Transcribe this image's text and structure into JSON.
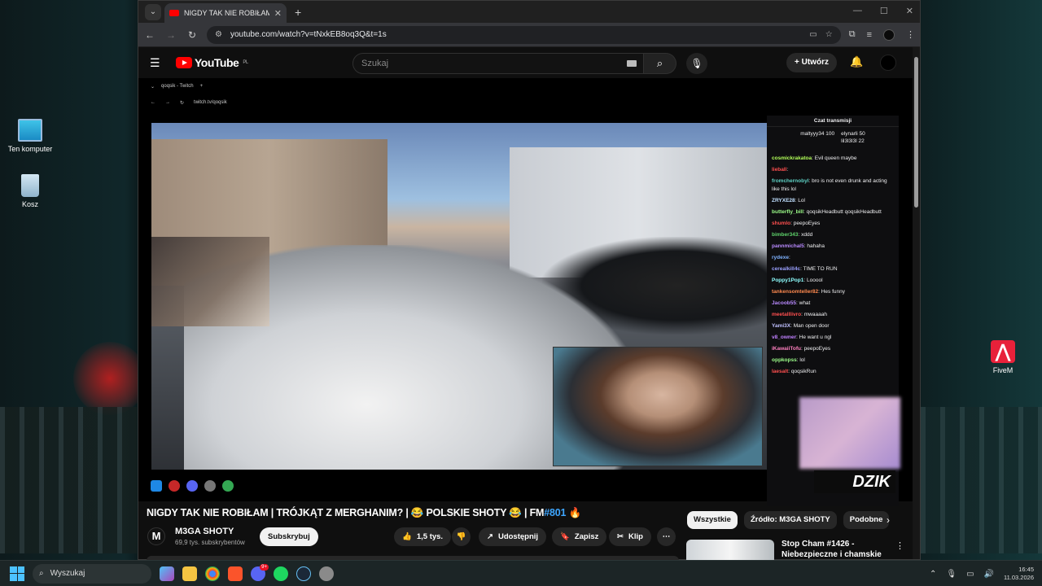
{
  "desktop": {
    "icons": [
      {
        "label": "Ten komputer"
      },
      {
        "label": "Kosz"
      },
      {
        "label": "FiveM"
      }
    ]
  },
  "browser": {
    "tab_title": "NIGDY TAK NIE ROBIŁAM | TRÓ",
    "url": "youtube.com/watch?v=tNxkEB8oq3Q&t=1s"
  },
  "youtube": {
    "logo_text": "YouTube",
    "logo_region": "PL",
    "search_placeholder": "Szukaj",
    "create_label": "Utwórz",
    "video": {
      "title_prefix": "NIGDY TAK NIE ROBIŁAM | TRÓJKĄT Z MERGHANIM? | 😂 POLSKIE SHOTY 😂 | FM",
      "title_hashtag": "#801",
      "title_suffix": " 🔥",
      "channel_name": "M3GA SHOTY",
      "channel_initial": "M",
      "subscribers": "69,9 tys. subskrybentów",
      "subscribe_label": "Subskrybuj",
      "likes": "1,5 tys.",
      "share_label": "Udostępnij",
      "save_label": "Zapisz",
      "clip_label": "Klip"
    },
    "chips": [
      "Wszystkie",
      "Źródło: M3GA SHOTY",
      "Podobne"
    ],
    "recommended": {
      "title": "Stop Cham #1426 - Niebezpieczne i chamskie ..."
    },
    "embedded": {
      "tab_title": "qoqsik - Twitch",
      "url": "twitch.tv/qoqsik",
      "chat_title": "Czat transmisji",
      "gift_lines": [
        "maltyyy34  100",
        "elynarli 50",
        "lil3l3l3l 22"
      ],
      "chat_messages": [
        {
          "user": "cosmickrakatoa",
          "text": "Evil queen maybe",
          "color": "#b2ff59"
        },
        {
          "user": "lieball",
          "text": "",
          "color": "#ff4f4f"
        },
        {
          "user": "fromchernobyl",
          "text": "bro is not even drunk and acting like this lol",
          "color": "#5fd3c6"
        },
        {
          "user": "ZRYXE28",
          "text": "Lol",
          "color": "#c0e0ff"
        },
        {
          "user": "butterfly_bill",
          "text": "qoqsikHeadbutt qoqsikHeadbutt",
          "color": "#9dff8a"
        },
        {
          "user": "shumlo",
          "text": "peepoEyes",
          "color": "#ff4f4f"
        },
        {
          "user": "bimber343",
          "text": "xddd",
          "color": "#5fd36c"
        },
        {
          "user": "pannmichal5",
          "text": "hahaha",
          "color": "#b98aff"
        },
        {
          "user": "rydexe",
          "text": "",
          "color": "#7fb2ff"
        },
        {
          "user": "cerealkill4c",
          "text": "TIME TO RUN",
          "color": "#9aa0ff"
        },
        {
          "user": "Poppy1Pop1",
          "text": "Looool",
          "color": "#8fffff"
        },
        {
          "user": "tankensomteller82",
          "text": "Hes funny",
          "color": "#ff8a4f"
        },
        {
          "user": "Jacoob55",
          "text": "what",
          "color": "#b98aff"
        },
        {
          "user": "meetalllivro",
          "text": "mwaaaah",
          "color": "#ff4f4f"
        },
        {
          "user": "Yami3X",
          "text": "Man open door",
          "color": "#c0c0ff"
        },
        {
          "user": "v8_owner",
          "text": "He want u ngl",
          "color": "#c080ff"
        },
        {
          "user": "iKawaiiTofu",
          "text": "peepoEyes",
          "color": "#ff80c0"
        },
        {
          "user": "oppkopss",
          "text": "lol",
          "color": "#9dff8a"
        },
        {
          "user": "laesalt",
          "text": "qoqsikRun",
          "color": "#ff4f4f"
        }
      ],
      "overlay_text": "DZIK"
    }
  },
  "taskbar": {
    "search_placeholder": "Wyszukaj",
    "discord_badge": "9+",
    "time": "16:45",
    "date": "11.03.2026"
  }
}
